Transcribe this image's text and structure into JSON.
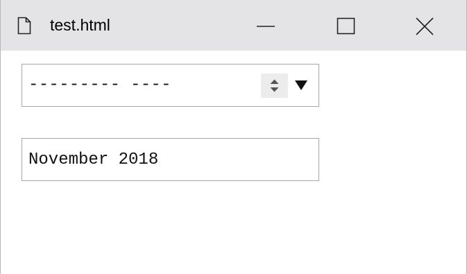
{
  "window": {
    "title": "test.html",
    "icon": "document-icon",
    "controls": {
      "minimize_icon": "minimize-icon",
      "maximize_icon": "maximize-icon",
      "close_icon": "close-icon"
    }
  },
  "month_picker": {
    "value": "--------- ----",
    "spin_icon": "spinner-updown-icon",
    "dropdown_icon": "dropdown-triangle-icon"
  },
  "text_field": {
    "value": "November 2018"
  },
  "colors": {
    "titlebar_bg": "#e4e4e6",
    "border": "#a6a6a6",
    "spin_bg": "#ececec"
  }
}
